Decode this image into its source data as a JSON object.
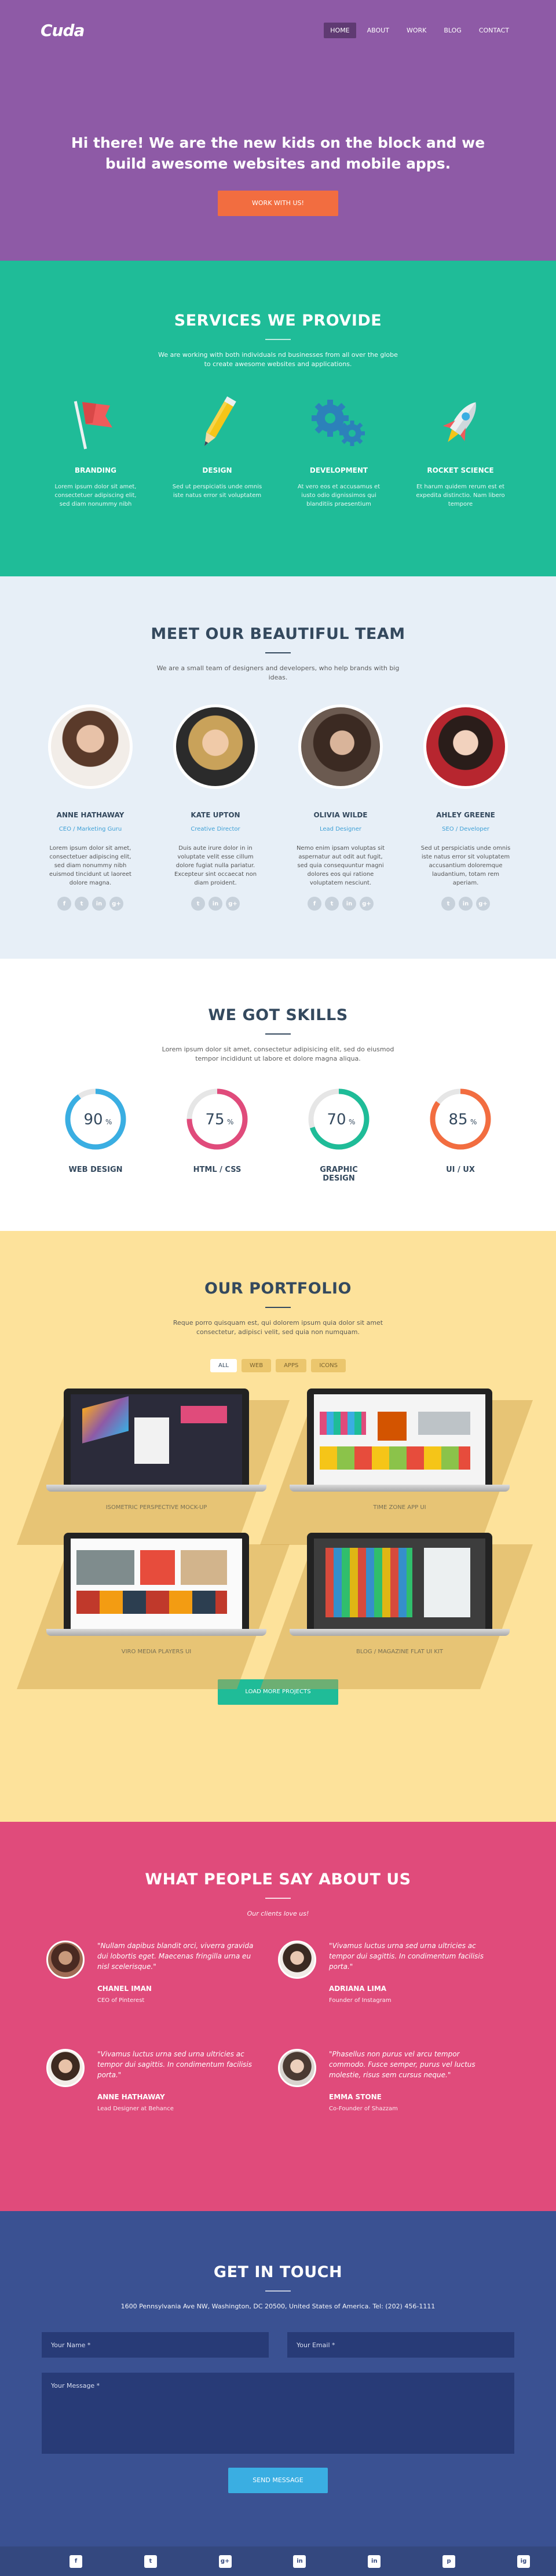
{
  "brand": {
    "logo": "Cuda"
  },
  "nav": {
    "items": [
      "HOME",
      "ABOUT",
      "WORK",
      "BLOG",
      "CONTACT"
    ]
  },
  "hero": {
    "headline": "Hi there! We are the new kids on the block and we build awesome websites and mobile apps.",
    "cta": "WORK WITH US!"
  },
  "services": {
    "title": "SERVICES WE PROVIDE",
    "subtitle": "We are working with both individuals nd businesses from all over the globe to create awesome websites and applications.",
    "items": [
      {
        "name": "BRANDING",
        "text": "Lorem ipsum dolor sit amet, consectetuer adipiscing elit, sed diam nonummy nibh",
        "icon": "flag-icon"
      },
      {
        "name": "DESIGN",
        "text": "Sed ut perspiciatis unde omnis iste natus error sit voluptatem",
        "icon": "pencil-icon"
      },
      {
        "name": "DEVELOPMENT",
        "text": "At vero eos et accusamus et iusto odio dignissimos qui blanditiis praesentium",
        "icon": "gears-icon"
      },
      {
        "name": "ROCKET SCIENCE",
        "text": "Et harum quidem rerum est et expedita distinctio. Nam libero tempore",
        "icon": "rocket-icon"
      }
    ]
  },
  "team": {
    "title": "MEET OUR BEAUTIFUL TEAM",
    "subtitle": "We are a small team of designers and developers, who help brands with big ideas.",
    "members": [
      {
        "name": "ANNE HATHAWAY",
        "role": "CEO / Marketing Guru",
        "bio": "Lorem ipsum dolor sit amet, consectetuer adipiscing elit, sed diam nonummy nibh euismod tincidunt ut laoreet dolore magna.",
        "socials": [
          "f",
          "t",
          "in",
          "g+"
        ]
      },
      {
        "name": "KATE UPTON",
        "role": "Creative Director",
        "bio": "Duis aute irure dolor in in voluptate velit esse cillum dolore fugiat nulla pariatur. Excepteur sint occaecat non diam proident.",
        "socials": [
          "t",
          "in",
          "g+"
        ]
      },
      {
        "name": "OLIVIA WILDE",
        "role": "Lead Designer",
        "bio": "Nemo enim ipsam voluptas sit aspernatur aut odit aut fugit, sed quia consequuntur magni dolores eos qui ratione voluptatem nesciunt.",
        "socials": [
          "f",
          "t",
          "in",
          "g+"
        ]
      },
      {
        "name": "AHLEY GREENE",
        "role": "SEO / Developer",
        "bio": "Sed ut perspiciatis unde omnis iste natus error sit voluptatem accusantium doloremque laudantium, totam rem aperiam.",
        "socials": [
          "t",
          "in",
          "g+"
        ]
      }
    ]
  },
  "skills": {
    "title": "WE GOT SKILLS",
    "subtitle": "Lorem ipsum dolor sit amet, consectetur adipisicing elit, sed do eiusmod tempor incididunt ut labore et dolore magna aliqua.",
    "items": [
      {
        "name": "WEB DESIGN",
        "percent": 90,
        "label": "90",
        "color": "#3aaee2"
      },
      {
        "name": "HTML / CSS",
        "percent": 75,
        "label": "75",
        "color": "#e04b7b"
      },
      {
        "name": "GRAPHIC DESIGN",
        "percent": 70,
        "label": "70",
        "color": "#1fbc98"
      },
      {
        "name": "UI / UX",
        "percent": 85,
        "label": "85",
        "color": "#f26d40"
      }
    ]
  },
  "portfolio": {
    "title": "OUR PORTFOLIO",
    "subtitle": "Reque porro quisquam est, qui dolorem ipsum quia dolor sit amet consectetur, adipisci velit, sed quia non numquam.",
    "filters": [
      "ALL",
      "WEB",
      "APPS",
      "ICONS"
    ],
    "projects": [
      {
        "name": "ISOMETRIC PERSPECTIVE MOCK-UP"
      },
      {
        "name": "TIME ZONE APP UI"
      },
      {
        "name": "VIRO MEDIA PLAYERS UI"
      },
      {
        "name": "BLOG / MAGAZINE FLAT UI KIT"
      }
    ],
    "load_more": "LOAD MORE PROJECTS"
  },
  "testimonials": {
    "title": "WHAT PEOPLE SAY ABOUT US",
    "subtitle": "Our clients love us!",
    "items": [
      {
        "quote": "\"Nullam dapibus blandit orci, viverra gravida dui lobortis eget. Maecenas fringilla urna eu nisl scelerisque.\"",
        "name": "CHANEL IMAN",
        "position": "CEO of Pinterest"
      },
      {
        "quote": "\"Vivamus luctus urna sed urna ultricies ac tempor dui sagittis. In condimentum facilisis porta.\"",
        "name": "ADRIANA LIMA",
        "position": "Founder of Instagram"
      },
      {
        "quote": "\"Vivamus luctus urna sed urna ultricies ac tempor dui sagittis. In condimentum facilisis porta.\"",
        "name": "ANNE HATHAWAY",
        "position": "Lead Designer at Behance"
      },
      {
        "quote": "\"Phasellus non purus vel arcu tempor commodo. Fusce semper, purus vel luctus molestie, risus sem cursus neque.\"",
        "name": "EMMA STONE",
        "position": "Co-Founder of Shazzam"
      }
    ]
  },
  "contact": {
    "title": "GET IN TOUCH",
    "address": "1600 Pennsylvania Ave NW, Washington, DC 20500, United States of America. Tel: (202) 456-1111",
    "name_placeholder": "Your Name *",
    "email_placeholder": "Your Email *",
    "message_placeholder": "Your Message *",
    "send": "SEND MESSAGE"
  },
  "footer": {
    "socials": [
      "f",
      "t",
      "g+",
      "in",
      "in",
      "p",
      "ig"
    ]
  },
  "colors": {
    "hero": "#8e5aa6",
    "services": "#1fbc98",
    "team": "#e7eff7",
    "portfolio": "#fde29b",
    "testimonials": "#e04b7b",
    "contact": "#3a5192",
    "accent": "#f26d40"
  }
}
